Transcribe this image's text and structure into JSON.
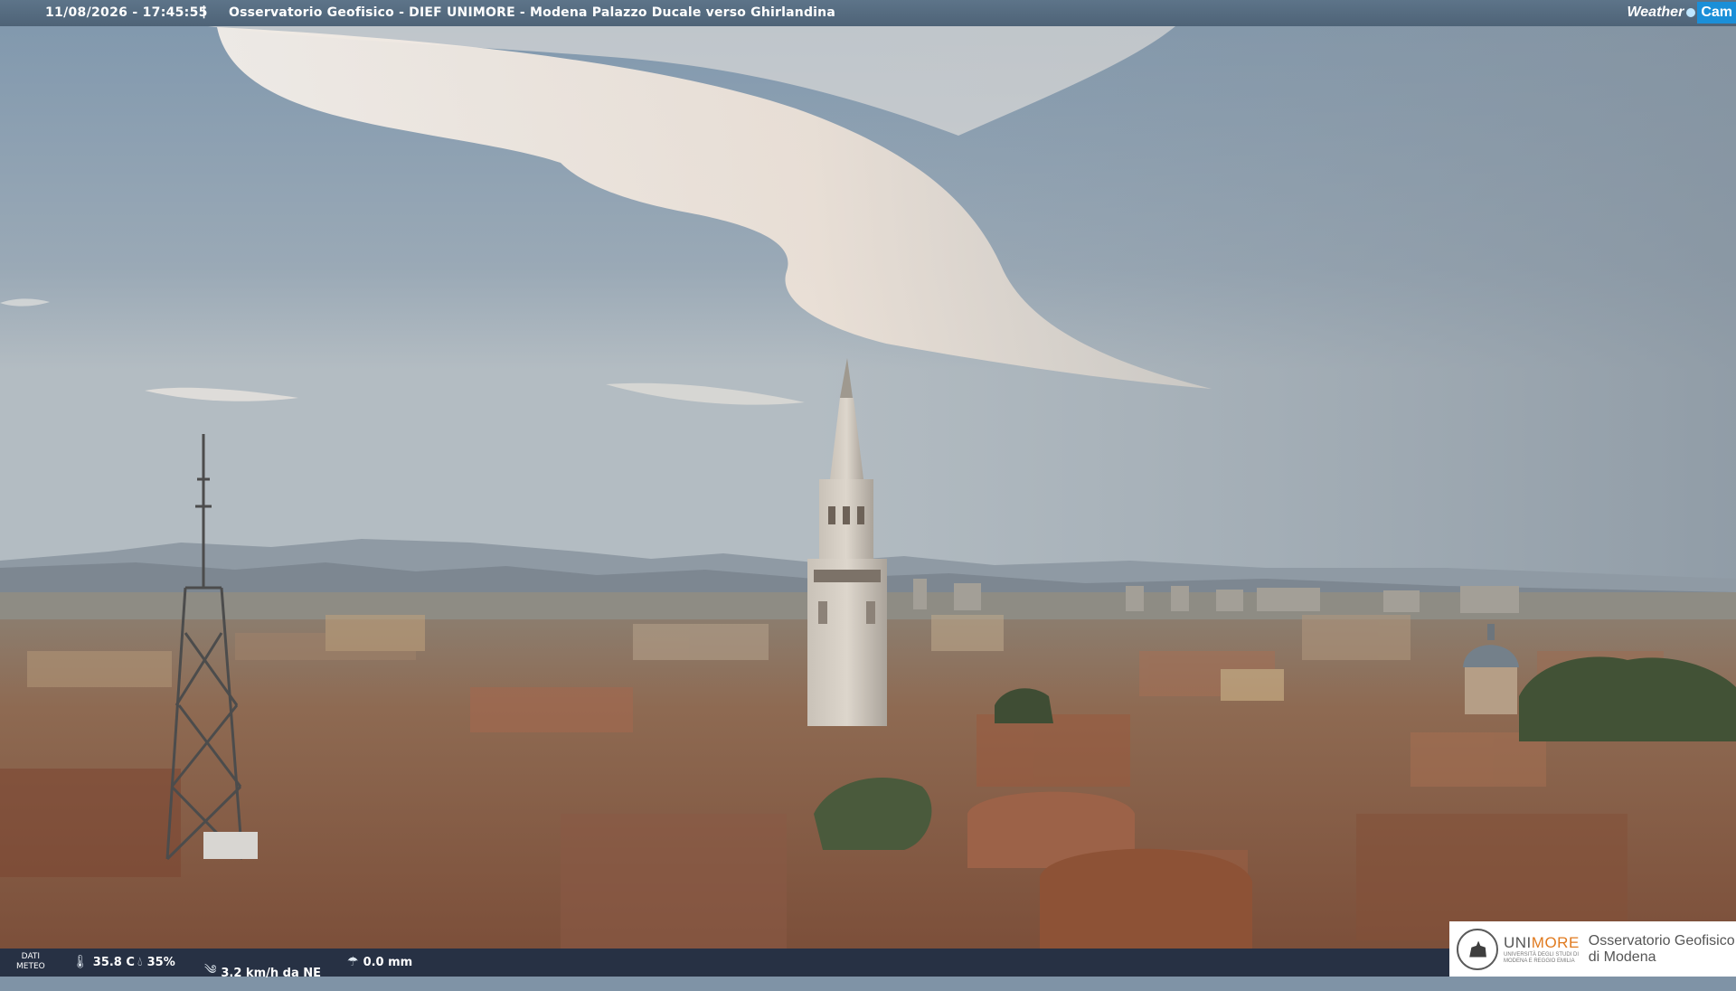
{
  "header": {
    "datetime": "11/08/2026 - 17:45:55",
    "separator": "|",
    "station": "Osservatorio Geofisico - DIEF UNIMORE - Modena Palazzo Ducale verso Ghirlandina",
    "logo_word": "Weather",
    "logo_cam": "Cam"
  },
  "weather": {
    "label_line1": "DATI",
    "label_line2": "METEO",
    "temperature": "35.8 C",
    "humidity": "35%",
    "wind": "3.2 km/h da NE",
    "rain": "0.0 mm"
  },
  "brand": {
    "uni_name_a": "UNI",
    "uni_name_b": "MORE",
    "uni_sub_1": "UNIVERSITÀ DEGLI STUDI DI",
    "uni_sub_2": "MODENA E REGGIO EMILIA",
    "obs_line1": "Osservatorio Geofisico",
    "obs_line2": "di Modena"
  },
  "icons": {
    "temperature": "thermometer-icon",
    "humidity": "droplet-icon",
    "wind": "wind-icon",
    "rain": "rain-gauge-icon"
  },
  "colors": {
    "sky_top": "#7f97ad",
    "sky_horizon": "#b3bcc2",
    "roof": "#8a5a43",
    "cloud": "#f3ece4",
    "bar": "#4e6377"
  }
}
